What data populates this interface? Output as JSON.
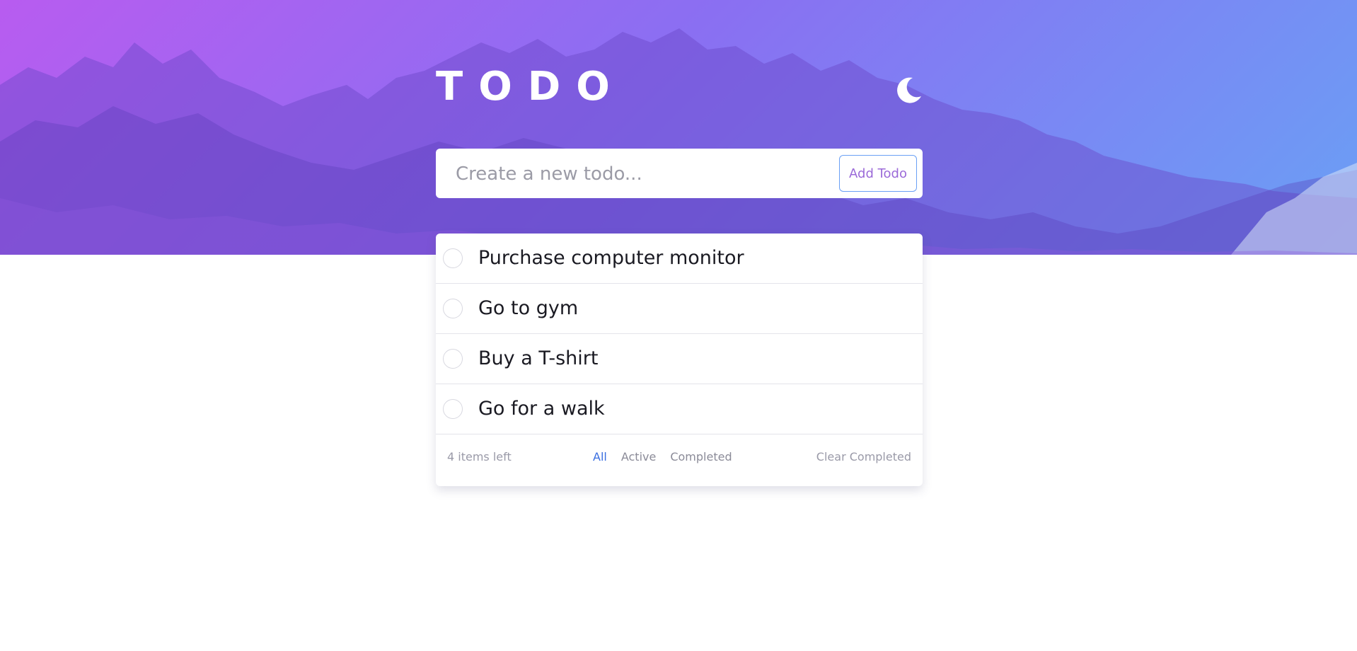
{
  "app": {
    "title": "TODO"
  },
  "new_todo": {
    "placeholder": "Create a new todo...",
    "value": "",
    "add_label": "Add Todo"
  },
  "todos": [
    {
      "text": "Purchase computer monitor",
      "completed": false
    },
    {
      "text": "Go to gym",
      "completed": false
    },
    {
      "text": "Buy a T-shirt",
      "completed": false
    },
    {
      "text": "Go for a walk",
      "completed": false
    }
  ],
  "footer": {
    "items_left": "4 items left",
    "filters": [
      {
        "label": "All",
        "active": true
      },
      {
        "label": "Active",
        "active": false
      },
      {
        "label": "Completed",
        "active": false
      }
    ],
    "clear_label": "Clear Completed"
  },
  "theme_toggle": {
    "icon": "moon-icon"
  },
  "colors": {
    "gradient_start": "#b85cf0",
    "gradient_end": "#6aa0f5",
    "active_filter": "#3a6ee0"
  }
}
